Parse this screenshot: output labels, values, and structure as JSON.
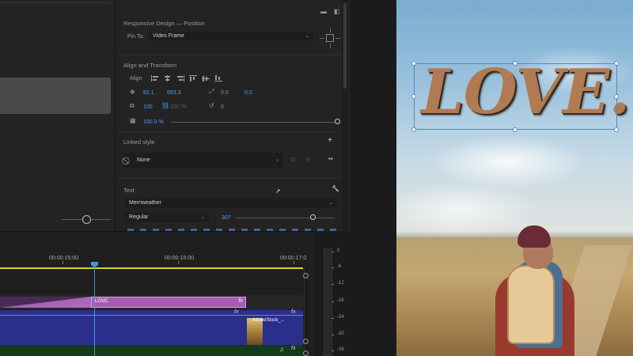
{
  "effect_controls": {
    "responsive_design_title": "Responsive Design — Position",
    "pin_to_label": "Pin To:",
    "pin_to_value": "Video Frame",
    "align_transform_title": "Align and Transform",
    "align_label": "Align",
    "position_x": "82.1",
    "position_y": "693.3",
    "anchor_x": "0.0",
    "anchor_y": "0.0",
    "scale_w": "100",
    "scale_h": "100",
    "rotation": "0",
    "opacity": "100.0 %",
    "linked_style_title": "Linked style",
    "linked_style_value": "None",
    "linked_style_count": "0",
    "text_title": "Text",
    "font_family": "Merriweather",
    "font_style": "Regular",
    "font_size": "307"
  },
  "timeline": {
    "timecodes": [
      "00:00:15:00",
      "00:00:16:00",
      "00:00:17:0"
    ],
    "clip_love_label": "LOVE.",
    "clip_adobe_label": "AdobeStock_...",
    "fx_label": "fx"
  },
  "audio_meter": {
    "db_labels": [
      "0",
      "-6",
      "-12",
      "-18",
      "-24",
      "-30",
      "-36"
    ]
  },
  "program": {
    "title_text": "LOVE."
  },
  "colors": {
    "accent_blue": "#4e9ef2",
    "graphics_clip": "#a55cb4",
    "video_track": "#2a2f8c",
    "audio_track": "#143a1e",
    "work_area": "#d8d22e"
  }
}
